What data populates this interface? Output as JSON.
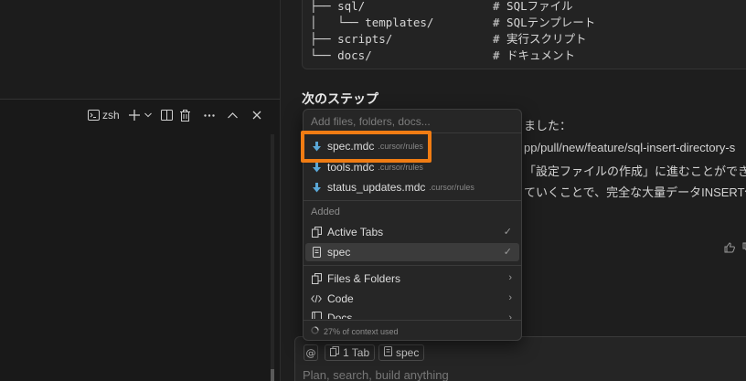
{
  "terminal": {
    "shell_label": "zsh"
  },
  "code_block": {
    "lines": [
      {
        "tree": "├── sql/",
        "comment": "# SQLファイル"
      },
      {
        "tree": "│   └── templates/",
        "comment": "# SQLテンプレート"
      },
      {
        "tree": "├── scripts/",
        "comment": "# 実行スクリプト"
      },
      {
        "tree": "└── docs/",
        "comment": "# ドキュメント"
      }
    ]
  },
  "chat": {
    "heading": "次のステップ",
    "line1": "ました：",
    "line2": "pp/pull/new/feature/sql-insert-directory-s",
    "line3": "「設定ファイルの作成」に進むことができま",
    "line4": "ていくことで、完全な大量データINSERT仕"
  },
  "popup": {
    "search_placeholder": "Add files, folders, docs...",
    "files": [
      {
        "name": "spec.mdc",
        "path": ".cursor/rules",
        "icon": "download-arrow-icon"
      },
      {
        "name": "tools.mdc",
        "path": ".cursor/rules",
        "icon": "download-arrow-icon"
      },
      {
        "name": "status_updates.mdc",
        "path": ".cursor/rules",
        "icon": "download-arrow-icon"
      }
    ],
    "added_label": "Added",
    "added": [
      {
        "name": "Active Tabs",
        "icon": "copy-icon",
        "check": "✓"
      },
      {
        "name": "spec",
        "icon": "file-icon",
        "check": "✓"
      }
    ],
    "categories": [
      {
        "name": "Files & Folders",
        "icon": "copy-icon",
        "arrow": "›"
      },
      {
        "name": "Code",
        "icon": "code-icon",
        "arrow": "›"
      },
      {
        "name": "Docs",
        "icon": "book-icon",
        "arrow": "›"
      }
    ],
    "context_usage": "27% of context used"
  },
  "composer": {
    "at_symbol": "@",
    "tab_chip": "1 Tab",
    "spec_chip": "spec",
    "placeholder": "Plan, search, build anything"
  },
  "colors": {
    "highlight": "#f07c13",
    "file_icon_blue": "#5aa7d6"
  }
}
